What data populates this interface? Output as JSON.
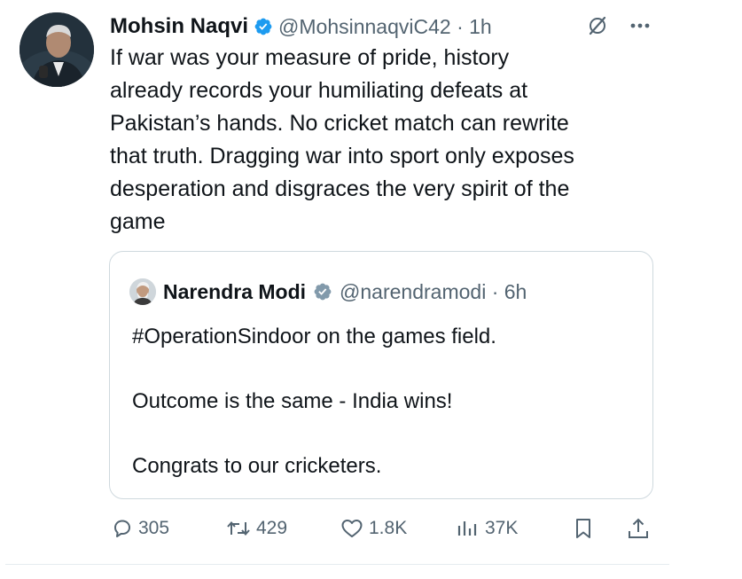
{
  "tweet": {
    "author": {
      "name": "Mohsin Naqvi",
      "handle": "@MohsinnaqviC42",
      "time": "1h"
    },
    "text": "If war was your measure of pride, history\nalready records your humiliating defeats at\nPakistan’s hands. No cricket match can rewrite\nthat truth. Dragging war into sport only exposes\ndesperation and disgraces the very spirit of the\ngame",
    "quote": {
      "author": {
        "name": "Narendra Modi",
        "handle": "@narendramodi",
        "time": "6h"
      },
      "text": "#OperationSindoor on the games field.\n\nOutcome is the same - India wins!\n\nCongrats to our cricketers."
    },
    "actions": {
      "replies": "305",
      "reposts": "429",
      "likes": "1.8K",
      "views": "37K"
    }
  },
  "icons": {
    "author_verified": "blue-check-verified-icon",
    "quote_verified": "gray-check-verified-icon",
    "grok": "grok-icon",
    "more": "more-horizontal-icon",
    "reply": "reply-bubble-icon",
    "repost": "repost-icon",
    "like": "heart-icon",
    "views": "views-bar-icon",
    "bookmark": "bookmark-icon",
    "share": "share-icon"
  },
  "colors": {
    "text_primary": "#0f1419",
    "text_secondary": "#536471",
    "verified_blue": "#1d9bf0",
    "verified_gray": "#829aab",
    "border": "#cfd9de"
  }
}
